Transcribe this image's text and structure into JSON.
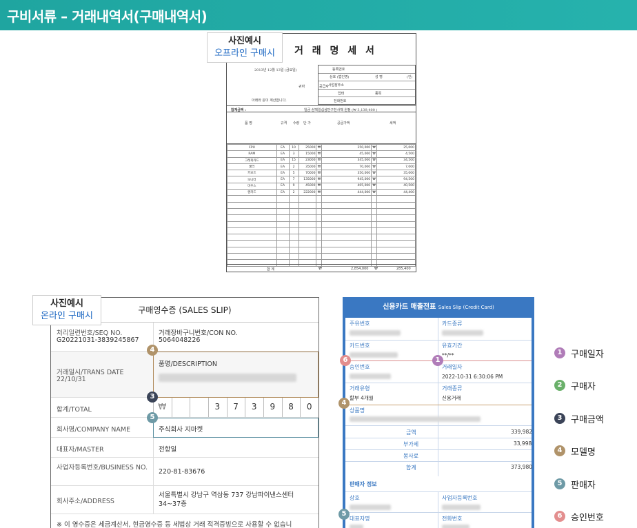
{
  "header": {
    "title": "구비서류 – 거래내역서(구매내역서)"
  },
  "offline": {
    "tag_line1": "사진예시",
    "tag_line2": "오프라인 구매시",
    "title": "거 래 명 세 서",
    "date_line": "2013년 12월 13일 (금요일)",
    "receiver": "귀하",
    "greeting": "아래와 같이 계산합니다.",
    "supplier_label": "공급자",
    "reg_no": "등록번호",
    "company": "상호 (법인명)",
    "name_label": "성 명",
    "seal": "(인)",
    "address": "사업장주소",
    "biz_type": "업태",
    "item_type": "종목",
    "phone": "전화번호",
    "sum_label": "합계금액 :",
    "sum_text": "일금 삼백일십삼만구천사백 원정 (₩          3,139,400     )",
    "headers": [
      "품    명",
      "규격",
      "수량",
      "단 가",
      "공급가액",
      "세액"
    ],
    "rows": [
      [
        "CPU",
        "EA",
        "10",
        "25000",
        "₩",
        "250,000",
        "₩",
        "25,000"
      ],
      [
        "RAM",
        "EA",
        "3",
        "15000",
        "₩",
        "45,000",
        "₩",
        "4,500"
      ],
      [
        "그래픽카드",
        "EA",
        "15",
        "23000",
        "₩",
        "345,000",
        "₩",
        "34,500"
      ],
      [
        "쿨러",
        "EA",
        "2",
        "35000",
        "₩",
        "70,000",
        "₩",
        "7,000"
      ],
      [
        "키보드",
        "EA",
        "5",
        "70000",
        "₩",
        "350,000",
        "₩",
        "35,000"
      ],
      [
        "모니터",
        "EA",
        "7",
        "135000",
        "₩",
        "945,000",
        "₩",
        "94,500"
      ],
      [
        "마우스",
        "EA",
        "9",
        "45000",
        "₩",
        "405,000",
        "₩",
        "40,500"
      ],
      [
        "랜카드",
        "EA",
        "2",
        "222000",
        "₩",
        "444,000",
        "₩",
        "44,400"
      ]
    ],
    "total_label": "합 계",
    "total_supply": "2,854,000",
    "total_tax": "285,400",
    "won": "₩"
  },
  "online": {
    "tag_line1": "사진예시",
    "tag_line2": "온라인 구매시",
    "title": "구매영수증 (SALES SLIP)",
    "seq_label": "처리일련번호/SEQ NO.",
    "seq_value": "G20221031-3839245867",
    "con_label": "거래장바구니번호/CON NO.",
    "con_value": "5064048226",
    "desc_label": "품명/DESCRIPTION",
    "date_label": "거래일시/TRANS DATE",
    "date_value": "22/10/31",
    "total_label": "합계/TOTAL",
    "currency": "₩",
    "digits": [
      "",
      "",
      "3",
      "7",
      "3",
      "9",
      "8",
      "0"
    ],
    "company_label": "회사명/COMPANY NAME",
    "company_value": "주식회사 지마켓",
    "master_label": "대표자/MASTER",
    "master_value": "전항일",
    "biz_label": "사업자등록번호/BUSINESS NO.",
    "biz_value": "220-81-83676",
    "addr_label": "회사주소/ADDRESS",
    "addr_value": "서울특별시 강남구 역삼동 737 강남파이낸스센터 34~37층",
    "note": "※ 이 영수증은 세금계산서, 현금영수증 등 세법상 거래 적격증빙으로 사용할 수 없습니"
  },
  "card": {
    "title": "신용카드 매출전표",
    "subtitle": "Sales Slip (Credit Card)",
    "owner_label": "주유번호",
    "card_type_label": "카드종류",
    "card_no_label": "카드번호",
    "valid_label": "유효기간",
    "valid_value": "**/**",
    "approval_label": "승인번호",
    "trans_date_label": "거래일자",
    "trans_date_value": "2022-10-31 6:30:06 PM",
    "trans_type_label": "거래유형",
    "trans_type_value": "할부 4개월",
    "trans_kind_label": "거래종류",
    "trans_kind_value": "신용거래",
    "product_label": "상품명",
    "amount_label": "금액",
    "amount_value": "339,982",
    "vat_label": "부가세",
    "vat_value": "33,998",
    "service_label": "봉사료",
    "total_label": "합계",
    "total_value": "373,980",
    "seller_section": "판매자 정보",
    "shop_label": "상호",
    "biz_no_label": "사업자등록번호",
    "ceo_label": "대표자명",
    "tel_label": "전화번호"
  },
  "legend": [
    {
      "num": "1",
      "label": "구매일자"
    },
    {
      "num": "2",
      "label": "구매자"
    },
    {
      "num": "3",
      "label": "구매금액"
    },
    {
      "num": "4",
      "label": "모델명"
    },
    {
      "num": "5",
      "label": "판매자"
    },
    {
      "num": "6",
      "label": "승인번호"
    }
  ]
}
